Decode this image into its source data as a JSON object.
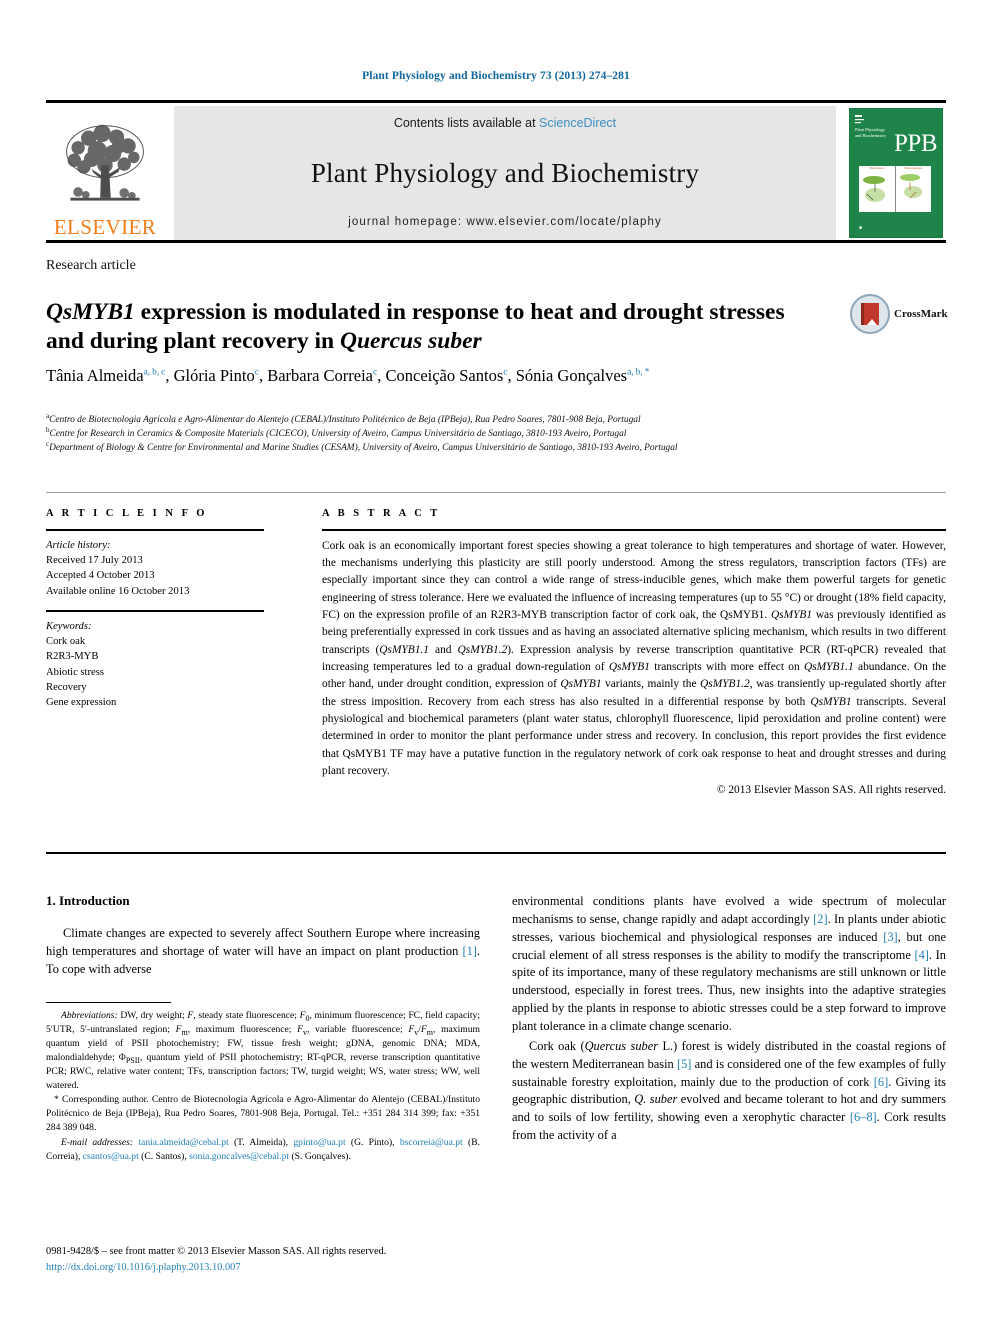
{
  "running_head": "Plant Physiology and Biochemistry 73 (2013) 274–281",
  "banner": {
    "publisher_name": "ELSEVIER",
    "contents_prefix": "Contents lists available at ",
    "contents_link": "ScienceDirect",
    "journal_name": "Plant Physiology and Biochemistry",
    "homepage": "journal homepage: www.elsevier.com/locate/plaphy",
    "cover": {
      "abbrev": "PPB",
      "cover_title": "Plant Physiology and Biochemistry",
      "fig_left_header": "Plant tissues",
      "fig_right_header": "Stress responses"
    }
  },
  "article": {
    "type": "Research article",
    "title_html": "<em>QsMYB1</em> expression is modulated in response to heat and drought stresses and during plant recovery in <em>Quercus suber</em>",
    "crossmark_label": "CrossMark",
    "authors_html": "Tânia Almeida<sup>a, b, c</sup>, Glória Pinto<sup>c</sup>, Barbara Correia<sup>c</sup>, Conceição Santos<sup>c</sup>, Sónia Gonçalves<sup>a, b, *</sup>",
    "affiliations": [
      {
        "mark": "a",
        "text": "Centro de Biotecnologia Agrícola e Agro-Alimentar do Alentejo (CEBAL)/Instituto Politécnico de Beja (IPBeja), Rua Pedro Soares, 7801-908 Beja, Portugal"
      },
      {
        "mark": "b",
        "text": "Centre for Research in Ceramics & Composite Materials (CICECO), University of Aveiro, Campus Universitário de Santiago, 3810-193 Aveiro, Portugal"
      },
      {
        "mark": "c",
        "text": "Department of Biology & Centre for Environmental and Marine Studies (CESAM), University of Aveiro, Campus Universitário de Santiago, 3810-193 Aveiro, Portugal"
      }
    ]
  },
  "article_info": {
    "heading": "A R T I C L E  I N F O",
    "history_label": "Article history:",
    "history": [
      "Received 17 July 2013",
      "Accepted 4 October 2013",
      "Available online 16 October 2013"
    ],
    "keywords_label": "Keywords:",
    "keywords": [
      "Cork oak",
      "R2R3-MYB",
      "Abiotic stress",
      "Recovery",
      "Gene expression"
    ]
  },
  "abstract": {
    "heading": "A B S T R A C T",
    "body_html": "Cork oak is an economically important forest species showing a great tolerance to high temperatures and shortage of water. However, the mechanisms underlying this plasticity are still poorly understood. Among the stress regulators, transcription factors (TFs) are especially important since they can control a wide range of stress-inducible genes, which make them powerful targets for genetic engineering of stress tolerance. Here we evaluated the influence of increasing temperatures (up to 55 °C) or drought (18% field capacity, FC) on the expression profile of an R2R3-MYB transcription factor of cork oak, the QsMYB1. <em>QsMYB1</em> was previously identified as being preferentially expressed in cork tissues and as having an associated alternative splicing mechanism, which results in two different transcripts (<em>QsMYB1.1</em> and <em>QsMYB1.2</em>). Expression analysis by reverse transcription quantitative PCR (RT-qPCR) revealed that increasing temperatures led to a gradual down-regulation of <em>QsMYB1</em> transcripts with more effect on <em>QsMYB1.1</em> abundance. On the other hand, under drought condition, expression of <em>QsMYB1</em> variants, mainly the <em>QsMYB1.2</em>, was transiently up-regulated shortly after the stress imposition. Recovery from each stress has also resulted in a differential response by both <em>QsMYB1</em> transcripts. Several physiological and biochemical parameters (plant water status, chlorophyll fluorescence, lipid peroxidation and proline content) were determined in order to monitor the plant performance under stress and recovery. In conclusion, this report provides the first evidence that QsMYB1 TF may have a putative function in the regulatory network of cork oak response to heat and drought stresses and during plant recovery.",
    "copyright": "© 2013 Elsevier Masson SAS. All rights reserved."
  },
  "introduction": {
    "heading": "1. Introduction",
    "left_paragraph_html": "Climate changes are expected to severely affect Southern Europe where increasing high temperatures and shortage of water will have an impact on plant production <span class=\"ref\">[1]</span>. To cope with adverse",
    "right_paragraph_1_html": "environmental conditions plants have evolved a wide spectrum of molecular mechanisms to sense, change rapidly and adapt accordingly <span class=\"ref\">[2]</span>. In plants under abiotic stresses, various biochemical and physiological responses are induced <span class=\"ref\">[3]</span>, but one crucial element of all stress responses is the ability to modify the transcriptome <span class=\"ref\">[4]</span>. In spite of its importance, many of these regulatory mechanisms are still unknown or little understood, especially in forest trees. Thus, new insights into the adaptive strategies applied by the plants in response to abiotic stresses could be a step forward to improve plant tolerance in a climate change scenario.",
    "right_paragraph_2_html": "Cork oak (<em>Quercus suber</em> L.) forest is widely distributed in the coastal regions of the western Mediterranean basin <span class=\"ref\">[5]</span> and is considered one of the few examples of fully sustainable forestry exploitation, mainly due to the production of cork <span class=\"ref\">[6]</span>. Giving its geographic distribution, <em>Q. suber</em> evolved and became tolerant to hot and dry summers and to soils of low fertility, showing even a xerophytic character <span class=\"ref\">[6–8]</span>. Cork results from the activity of a"
  },
  "footnotes": {
    "abbreviations_html": "<em>Abbreviations:</em> DW, dry weight; <em>F</em>, steady state fluorescence; <em>F</em><sub>0</sub>, minimum fluorescence; FC, field capacity; 5′UTR, 5′-untranslated region; <em>F</em><sub>m</sub>, maximum fluorescence; <em>F</em><sub>v</sub>, variable fluorescence; <em>F</em><sub>v</sub>/<em>F</em><sub>m</sub>, maximum quantum yield of PSII photochemistry; FW, tissue fresh weight; gDNA, genomic DNA; MDA, malondialdehyde; Φ<sub>PSII</sub>, quantum yield of PSII photochemistry; RT-qPCR, reverse transcription quantitative PCR; RWC, relative water content; TFs, transcription factors; TW, turgid weight; WS, water stress; WW, well watered.",
    "corresponding_html": "* Corresponding author. Centro de Biotecnologia Agrícola e Agro-Alimentar do Alentejo (CEBAL)/Instituto Politécnico de Beja (IPBeja), Rua Pedro Soares, 7801-908 Beja, Portugal. Tel.: +351 284 314 399; fax: +351 284 389 048.",
    "emails_html": "<em>E-mail addresses:</em> <span class=\"mail\">tania.almeida@cebal.pt</span> (T. Almeida), <span class=\"mail\">gpinto@ua.pt</span> (G. Pinto), <span class=\"mail\">bscorreia@ua.pt</span> (B. Correia), <span class=\"mail\">csantos@ua.pt</span> (C. Santos), <span class=\"mail\">sonia.goncalves@cebal.pt</span> (S. Gonçalves)."
  },
  "footer": {
    "issn_line": "0981-9428/$ – see front matter © 2013 Elsevier Masson SAS. All rights reserved.",
    "doi": "http://dx.doi.org/10.1016/j.plaphy.2013.10.007"
  },
  "colors": {
    "link_blue": "#1f7fb6",
    "header_blue": "#11689e",
    "elsevier_orange": "#f07c1a",
    "cover_green": "#1e8449"
  }
}
